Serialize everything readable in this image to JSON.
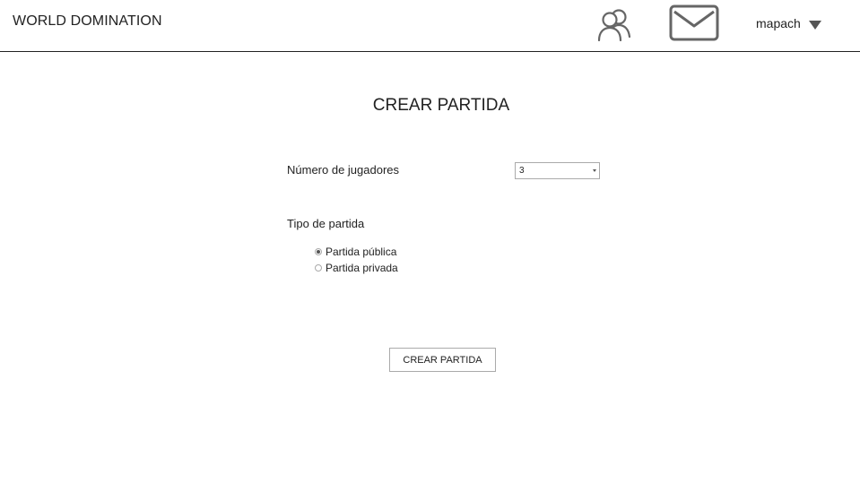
{
  "header": {
    "brand": "WORLD DOMINATION",
    "icons": {
      "friends": "users-icon",
      "messages": "envelope-icon",
      "user_menu": "caret-down-icon"
    },
    "username": "mapach"
  },
  "main": {
    "title": "CREAR PARTIDA",
    "players": {
      "label": "Número de jugadores",
      "selected_value": "3"
    },
    "game_type": {
      "label": "Tipo de partida",
      "options": [
        {
          "label": "Partida pública",
          "checked": true
        },
        {
          "label": "Partida privada",
          "checked": false
        }
      ]
    },
    "submit_label": "CREAR PARTIDA"
  }
}
